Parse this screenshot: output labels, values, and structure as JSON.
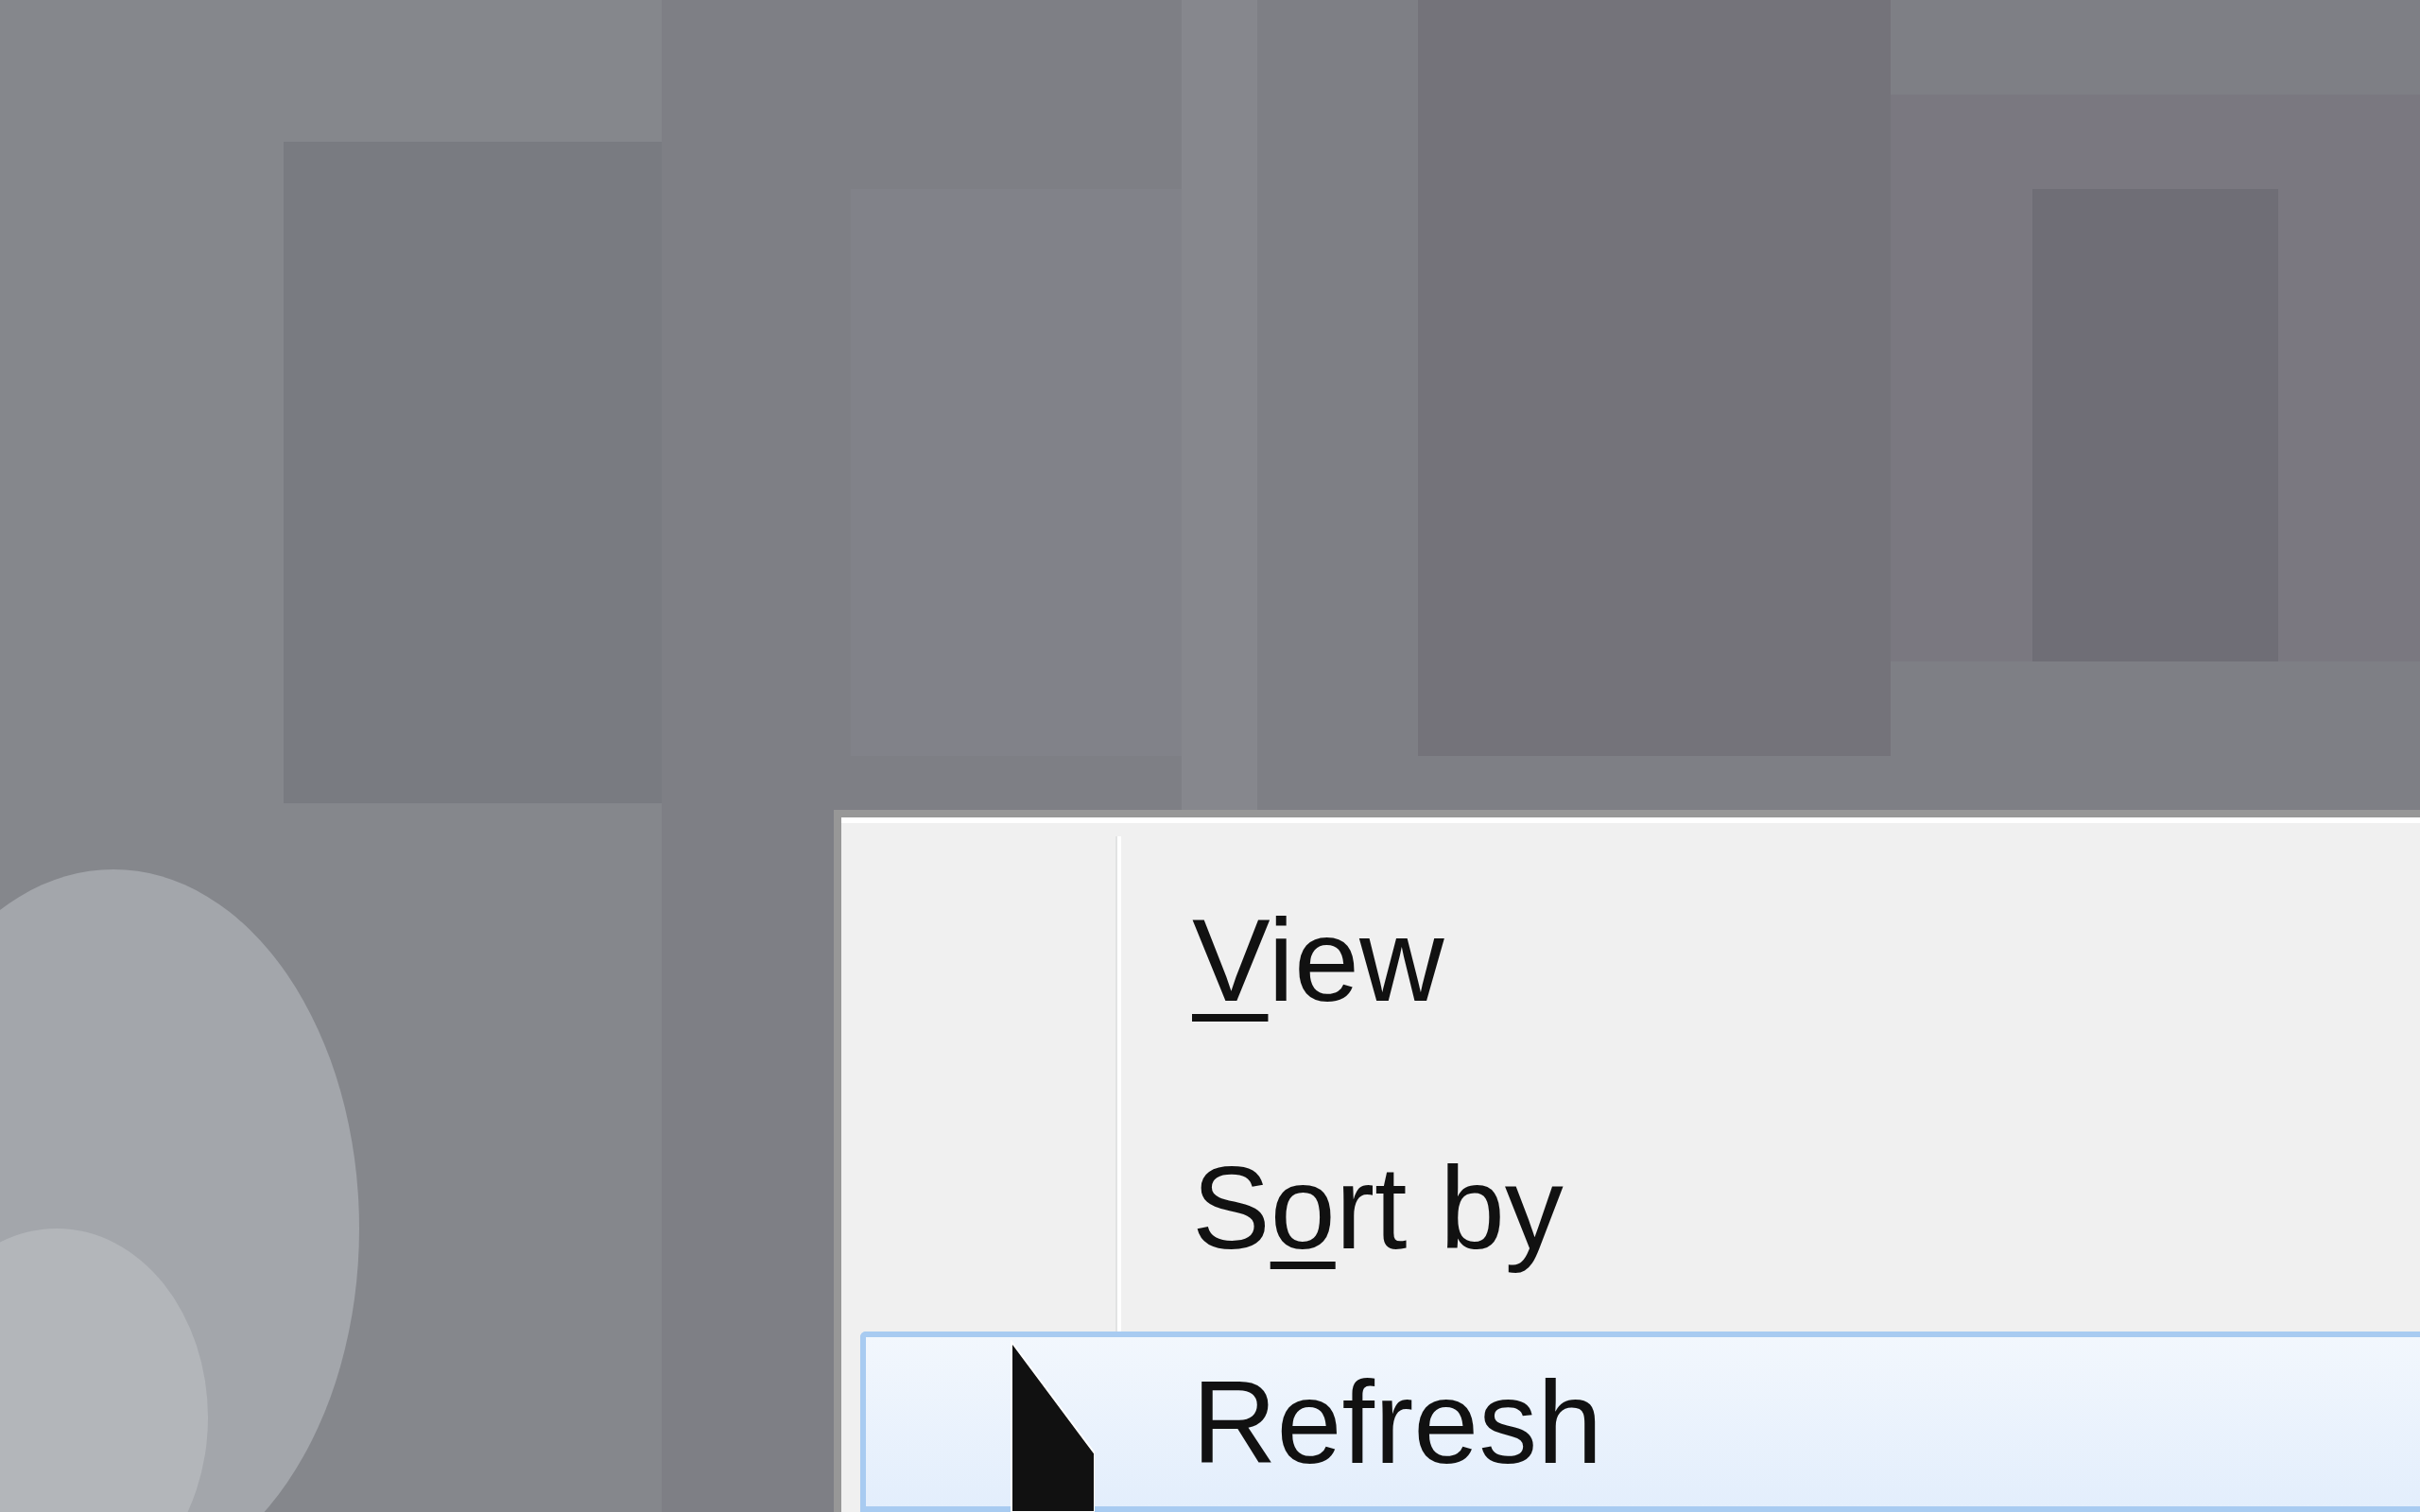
{
  "context_menu": {
    "items": [
      {
        "label_parts": {
          "key": "V",
          "after": "iew"
        },
        "selected": false
      },
      {
        "label_parts": {
          "before": "S",
          "key": "o",
          "after": "rt by"
        },
        "selected": false
      },
      {
        "label_parts": {
          "after": "Refresh"
        },
        "selected": true
      }
    ]
  }
}
